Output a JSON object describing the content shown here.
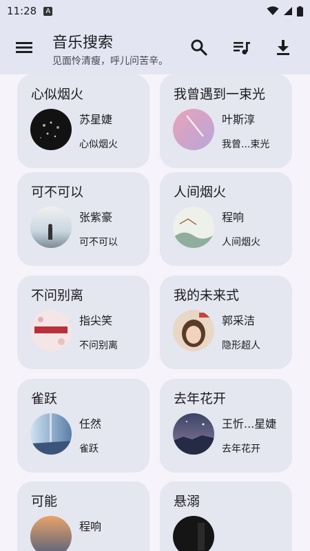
{
  "status_bar": {
    "time": "11:28",
    "notification_icon": "A"
  },
  "app_bar": {
    "title": "音乐搜索",
    "subtitle": "见面怜清瘦，呼儿问苦辛。",
    "icons": [
      "menu-icon",
      "search-icon",
      "playlist-icon",
      "download-icon"
    ]
  },
  "songs": [
    {
      "title": "心似烟火",
      "artist": "苏星婕",
      "album": "心似烟火"
    },
    {
      "title": "我曾遇到一束光",
      "artist": "叶斯淳",
      "album": "我曾...束光"
    },
    {
      "title": "可不可以",
      "artist": "张紫豪",
      "album": "可不可以"
    },
    {
      "title": "人间烟火",
      "artist": "程响",
      "album": "人间烟火"
    },
    {
      "title": "不问别离",
      "artist": "指尖笑",
      "album": "不问别离"
    },
    {
      "title": "我的未来式",
      "artist": "郭采洁",
      "album": "隐形超人"
    },
    {
      "title": "雀跃",
      "artist": "任然",
      "album": "雀跃"
    },
    {
      "title": "去年花开",
      "artist": "王忻...星婕",
      "album": "去年花开"
    },
    {
      "title": "可能",
      "artist": "程响",
      "album": ""
    },
    {
      "title": "悬溺",
      "artist": "",
      "album": ""
    }
  ],
  "colors": {
    "app_bar": "#e3e6f2",
    "background": "#f6f3fa",
    "card": "#e4e6f0"
  }
}
